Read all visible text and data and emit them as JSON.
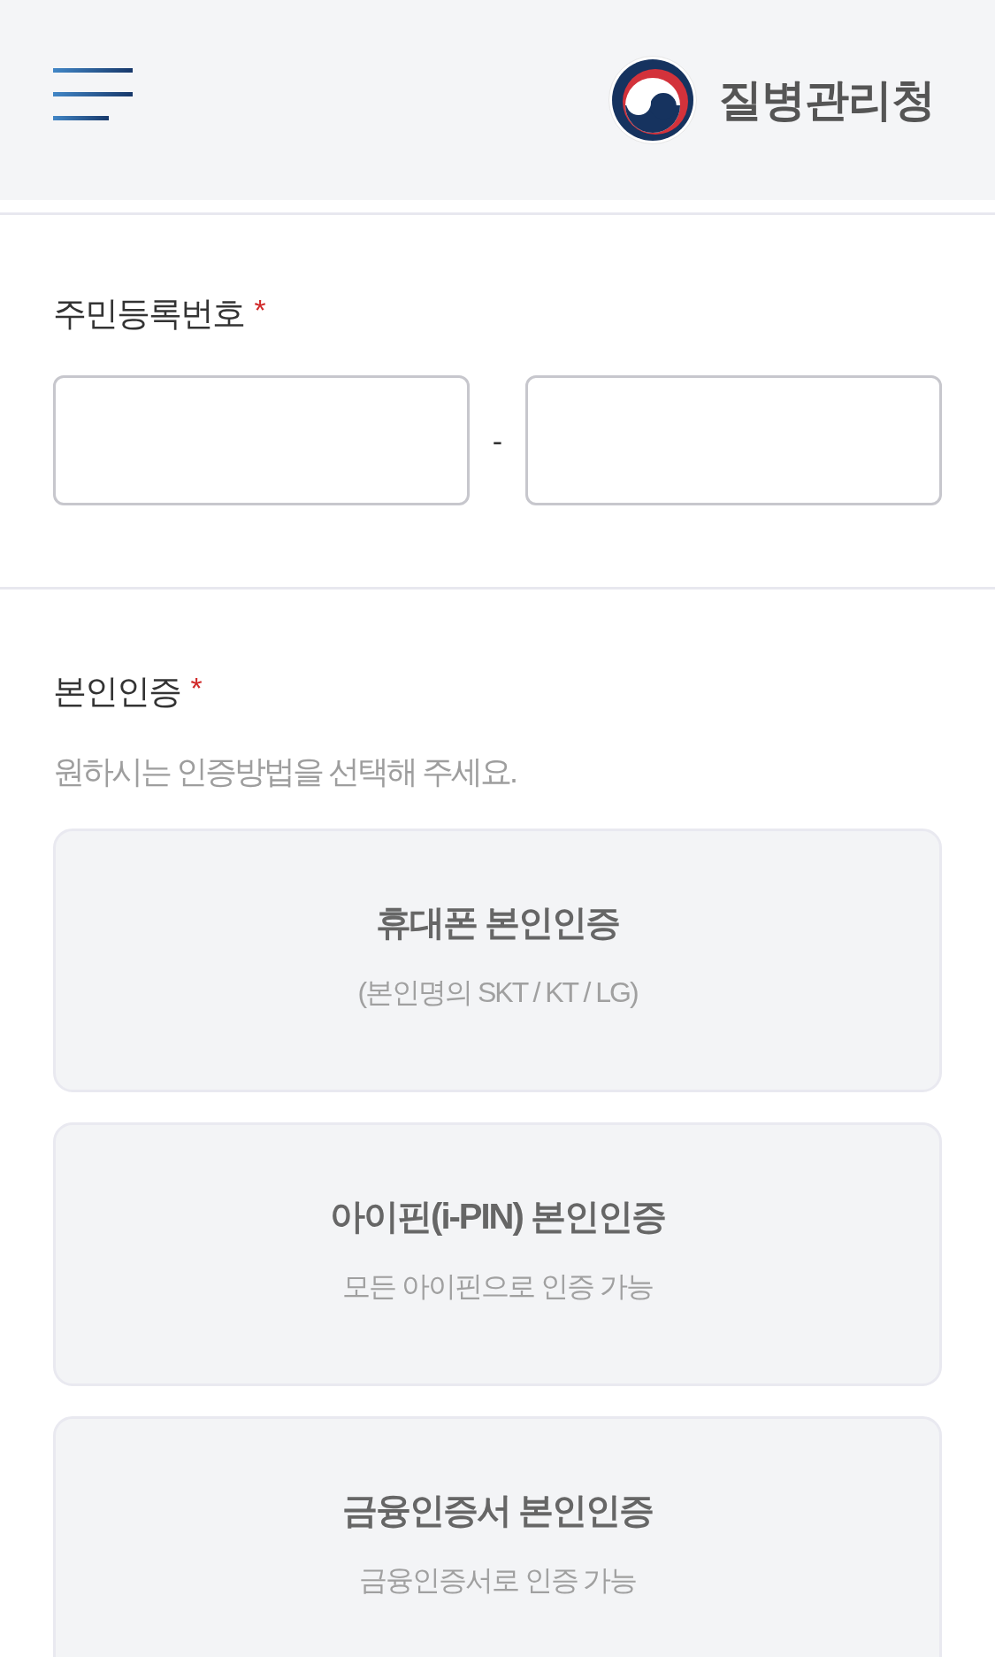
{
  "header": {
    "brand_name": "질병관리청"
  },
  "required_mark": "*",
  "resident_number": {
    "label": "주민등록번호",
    "required": true,
    "separator": "-"
  },
  "verification": {
    "label": "본인인증",
    "required": true,
    "hint": "원하시는 인증방법을 선택해 주세요.",
    "options": [
      {
        "title": "휴대폰 본인인증",
        "subtitle": "(본인명의 SKT / KT / LG)",
        "selected": false
      },
      {
        "title": "아이핀(i-PIN) 본인인증",
        "subtitle": "모든 아이핀으로 인증 가능",
        "selected": false
      },
      {
        "title": "금융인증서 본인인증",
        "subtitle": "금융인증서로 인증 가능",
        "selected": false
      }
    ]
  }
}
